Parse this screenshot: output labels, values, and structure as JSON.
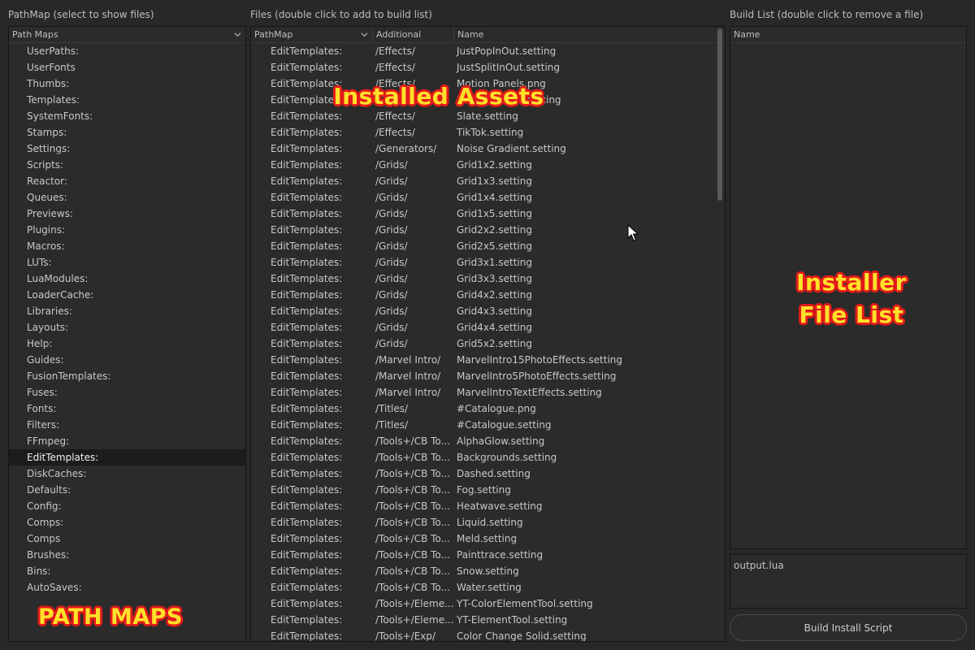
{
  "left_panel": {
    "title": "PathMap (select to show files)",
    "header": "Path Maps",
    "selected": "EditTemplates:",
    "items": [
      "UserPaths:",
      "UserFonts",
      "Thumbs:",
      "Templates:",
      "SystemFonts:",
      "Stamps:",
      "Settings:",
      "Scripts:",
      "Reactor:",
      "Queues:",
      "Previews:",
      "Plugins:",
      "Macros:",
      "LUTs:",
      "LuaModules:",
      "LoaderCache:",
      "Libraries:",
      "Layouts:",
      "Help:",
      "Guides:",
      "FusionTemplates:",
      "Fuses:",
      "Fonts:",
      "Filters:",
      "FFmpeg:",
      "EditTemplates:",
      "DiskCaches:",
      "Defaults:",
      "Config:",
      "Comps:",
      "Comps",
      "Brushes:",
      "Bins:",
      "AutoSaves:"
    ]
  },
  "files_panel": {
    "title": "Files (double click to add to build list)",
    "columns": [
      "PathMap",
      "Additional",
      "Name"
    ],
    "rows": [
      [
        "EditTemplates:",
        "/Effects/",
        "JustPopInOut.setting"
      ],
      [
        "EditTemplates:",
        "/Effects/",
        "JustSplitInOut.setting"
      ],
      [
        "EditTemplates:",
        "/Effects/",
        "Motion Panels.png"
      ],
      [
        "EditTemplates:",
        "/Effects/",
        "Motion Panels.setting"
      ],
      [
        "EditTemplates:",
        "/Effects/",
        "Slate.setting"
      ],
      [
        "EditTemplates:",
        "/Effects/",
        "TikTok.setting"
      ],
      [
        "EditTemplates:",
        "/Generators/",
        "Noise Gradient.setting"
      ],
      [
        "EditTemplates:",
        "/Grids/",
        "Grid1x2.setting"
      ],
      [
        "EditTemplates:",
        "/Grids/",
        "Grid1x3.setting"
      ],
      [
        "EditTemplates:",
        "/Grids/",
        "Grid1x4.setting"
      ],
      [
        "EditTemplates:",
        "/Grids/",
        "Grid1x5.setting"
      ],
      [
        "EditTemplates:",
        "/Grids/",
        "Grid2x2.setting"
      ],
      [
        "EditTemplates:",
        "/Grids/",
        "Grid2x5.setting"
      ],
      [
        "EditTemplates:",
        "/Grids/",
        "Grid3x1.setting"
      ],
      [
        "EditTemplates:",
        "/Grids/",
        "Grid3x3.setting"
      ],
      [
        "EditTemplates:",
        "/Grids/",
        "Grid4x2.setting"
      ],
      [
        "EditTemplates:",
        "/Grids/",
        "Grid4x3.setting"
      ],
      [
        "EditTemplates:",
        "/Grids/",
        "Grid4x4.setting"
      ],
      [
        "EditTemplates:",
        "/Grids/",
        "Grid5x2.setting"
      ],
      [
        "EditTemplates:",
        "/Marvel Intro/",
        "MarvelIntro15PhotoEffects.setting"
      ],
      [
        "EditTemplates:",
        "/Marvel Intro/",
        "MarvelIntro5PhotoEffects.setting"
      ],
      [
        "EditTemplates:",
        "/Marvel Intro/",
        "MarvelIntroTextEffects.setting"
      ],
      [
        "EditTemplates:",
        "/Titles/",
        "#Catalogue.png"
      ],
      [
        "EditTemplates:",
        "/Titles/",
        "#Catalogue.setting"
      ],
      [
        "EditTemplates:",
        "/Tools+/CB To...",
        "AlphaGlow.setting"
      ],
      [
        "EditTemplates:",
        "/Tools+/CB To...",
        "Backgrounds.setting"
      ],
      [
        "EditTemplates:",
        "/Tools+/CB To...",
        "Dashed.setting"
      ],
      [
        "EditTemplates:",
        "/Tools+/CB To...",
        "Fog.setting"
      ],
      [
        "EditTemplates:",
        "/Tools+/CB To...",
        "Heatwave.setting"
      ],
      [
        "EditTemplates:",
        "/Tools+/CB To...",
        "Liquid.setting"
      ],
      [
        "EditTemplates:",
        "/Tools+/CB To...",
        "Meld.setting"
      ],
      [
        "EditTemplates:",
        "/Tools+/CB To...",
        "Painttrace.setting"
      ],
      [
        "EditTemplates:",
        "/Tools+/CB To...",
        "Snow.setting"
      ],
      [
        "EditTemplates:",
        "/Tools+/CB To...",
        "Water.setting"
      ],
      [
        "EditTemplates:",
        "/Tools+/Eleme...",
        "YT-ColorElementTool.setting"
      ],
      [
        "EditTemplates:",
        "/Tools+/Eleme...",
        "YT-ElementTool.setting"
      ],
      [
        "EditTemplates:",
        "/Tools+/Exp/",
        "Color Change Solid.setting"
      ]
    ]
  },
  "build_panel": {
    "title": "Build List (double click to remove a file)",
    "header": "Name",
    "output_value": "output.lua",
    "button_label": "Build Install Script"
  },
  "overlays": {
    "installed_assets": "Installed Assets",
    "installer_line1": "Installer",
    "installer_line2": "File List",
    "path_maps": "PATH MAPS"
  },
  "colors": {
    "background": "#282828",
    "overlay_text": "#ffe02a",
    "overlay_outline": "#e31a1a"
  }
}
